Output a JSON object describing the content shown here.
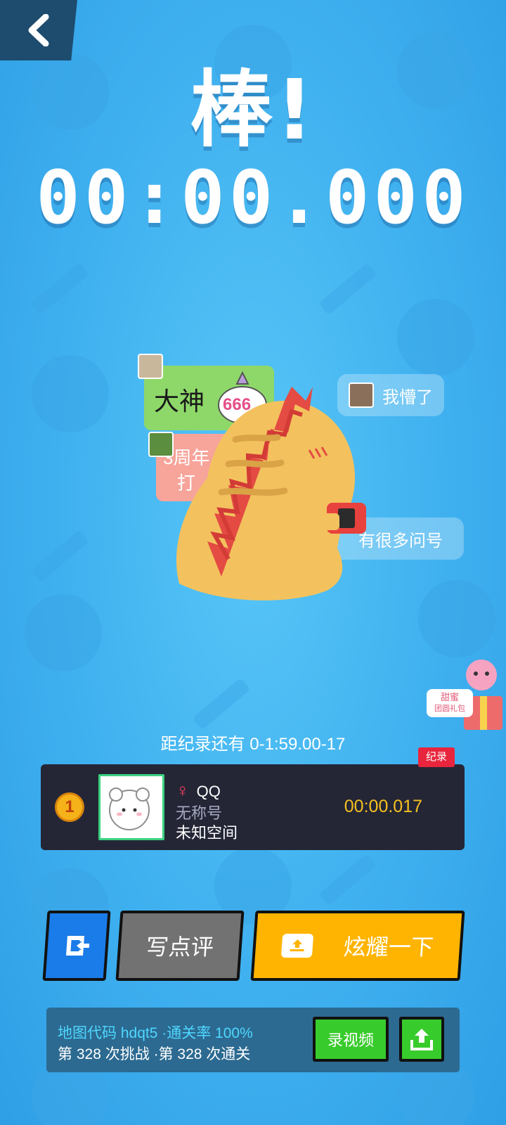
{
  "header": {
    "back_icon": "chevron-left-icon"
  },
  "result": {
    "title": "棒!",
    "time": "00:00.000"
  },
  "danmaku": [
    {
      "text": "大神"
    },
    {
      "text": "666"
    },
    {
      "text": "3周年"
    },
    {
      "text": "打"
    },
    {
      "text": "我懵了"
    },
    {
      "text": "有很多问号"
    }
  ],
  "gift": {
    "label_line1": "甜蜜",
    "label_line2": "团圆礼包"
  },
  "record_hint": "距纪录还有 0-1:59.00-17",
  "leaderboard": {
    "record_tag": "纪录",
    "rank": "1",
    "gender_icon": "♀",
    "name": "QQ",
    "title": "无称号",
    "space": "未知空间",
    "time": "00:00.017"
  },
  "actions": {
    "exit_icon": "exit-icon",
    "review_label": "写点评",
    "share_label": "炫耀一下"
  },
  "bottom": {
    "map_code_label": "地图代码 hdqt5",
    "pass_rate_label": "·通关率 100%",
    "challenge_label": "第 328 次挑战",
    "clear_label": "·第 328 次通关",
    "record_video_label": "录视频"
  },
  "colors": {
    "accent_yellow": "#ffb402",
    "accent_green": "#38cb2c",
    "time_gold": "#f6c020",
    "record_red": "#e8253c"
  }
}
